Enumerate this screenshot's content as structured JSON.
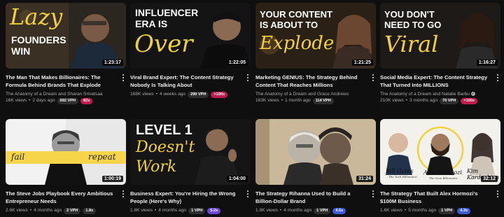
{
  "colors": {
    "background": "#0f0f0f",
    "thumb_yellow": "#f2d23a",
    "vph_badge": "#2e2e2e",
    "red_badge": "#c01a4f",
    "blue_badge": "#3d5bd9"
  },
  "videos": [
    {
      "thumb_lines": [
        "Lazy",
        "FOUNDERS",
        "WIN"
      ],
      "duration": "1:23:17",
      "title": "The Man That Makes Billionaires: The Formula Behind Brands That Explode",
      "channel": "The Anatomy of a Dream and Sharan Srivatsaa",
      "views": "16K views",
      "age": "2 days ago",
      "vph": "692 VPH",
      "multiplier": "82x",
      "multiplier_color": "#c01a4f"
    },
    {
      "thumb_lines": [
        "INFLUENCER",
        "ERA IS",
        "Over"
      ],
      "duration": "1:22:05",
      "title": "Viral Brand Expert: The Content Strategy Nobody Is Talking About",
      "channel": "",
      "views": "168K views",
      "age": "4 weeks ago",
      "vph": "290 VPH",
      "multiplier": ">100x",
      "multiplier_color": "#c01a4f"
    },
    {
      "thumb_lines": [
        "YOUR CONTENT",
        "IS ABOUT TO",
        "Explode"
      ],
      "duration": "1:21:25",
      "title": "Marketing GENIUS: The Strategy Behind Content That Reaches Millions",
      "channel": "The Anatomy of a Dream and Grace Andrews",
      "views": "163K views",
      "age": "1 month ago",
      "vph": "114 VPH",
      "multiplier": "",
      "multiplier_color": ""
    },
    {
      "thumb_lines": [
        "YOU DON'T",
        "NEED TO GO",
        "Viral"
      ],
      "duration": "1:16:27",
      "title": "Social Media Expert: The Content Strategy That Turned Into MILLIONS",
      "channel": "The Anatomy of a Dream and Natalie Barbu",
      "views": "210K views",
      "age": "3 months ago",
      "vph": "70 VPH",
      "multiplier": ">100x",
      "multiplier_color": "#c01a4f"
    },
    {
      "thumb_lines": [
        "fail",
        "repeat"
      ],
      "duration": "1:00:19",
      "title": "The Steve Jobs Playbook Every Ambitious Entrepreneur Needs",
      "channel": "",
      "views": "2.6K views",
      "age": "4 months ago",
      "vph": "2 VPH",
      "multiplier": "1.8x",
      "multiplier_color": "#2e2e2e"
    },
    {
      "thumb_lines": [
        "LEVEL 1",
        "Doesn't",
        "Work"
      ],
      "duration": "1:04:00",
      "title": "Business Expert: You're Hiring the Wrong People (Here's Why)",
      "channel": "",
      "views": "1.8K views",
      "age": "4 months ago",
      "vph": "1 VPH",
      "multiplier": "5.2x",
      "multiplier_color": "#6b47d6"
    },
    {
      "thumb_lines": [],
      "duration": "31:24",
      "title": "The Strategy Rihanna Used to Build a Billion-Dollar Brand",
      "channel": "",
      "views": "1.8K views",
      "age": "4 months ago",
      "vph": "1 VPH",
      "multiplier": "4.5x",
      "multiplier_color": "#3d5bd9"
    },
    {
      "thumb_lines": [
        "Bill Gates",
        "Alex Hormozi",
        "Kim Kardashian",
        "The Tech Billionaire",
        "The New Billionaire",
        "The Influencer"
      ],
      "duration": "32:12",
      "title": "The Strategy That Built Alex Hormozi's $100M Business",
      "channel": "",
      "views": "1.6K views",
      "age": "5 months ago",
      "vph": "1 VPH",
      "multiplier": "4.3x",
      "multiplier_color": "#3d5bd9"
    }
  ]
}
